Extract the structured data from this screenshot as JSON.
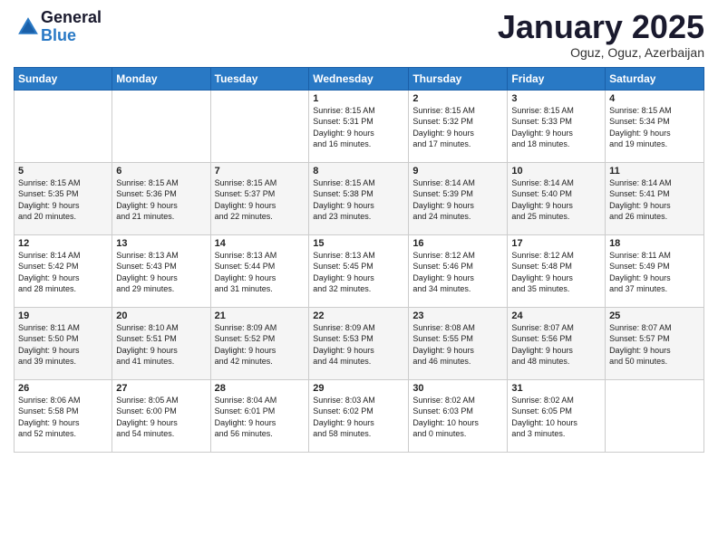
{
  "logo": {
    "general": "General",
    "blue": "Blue"
  },
  "title": "January 2025",
  "location": "Oguz, Oguz, Azerbaijan",
  "headers": [
    "Sunday",
    "Monday",
    "Tuesday",
    "Wednesday",
    "Thursday",
    "Friday",
    "Saturday"
  ],
  "weeks": [
    [
      {
        "day": "",
        "info": ""
      },
      {
        "day": "",
        "info": ""
      },
      {
        "day": "",
        "info": ""
      },
      {
        "day": "1",
        "info": "Sunrise: 8:15 AM\nSunset: 5:31 PM\nDaylight: 9 hours\nand 16 minutes."
      },
      {
        "day": "2",
        "info": "Sunrise: 8:15 AM\nSunset: 5:32 PM\nDaylight: 9 hours\nand 17 minutes."
      },
      {
        "day": "3",
        "info": "Sunrise: 8:15 AM\nSunset: 5:33 PM\nDaylight: 9 hours\nand 18 minutes."
      },
      {
        "day": "4",
        "info": "Sunrise: 8:15 AM\nSunset: 5:34 PM\nDaylight: 9 hours\nand 19 minutes."
      }
    ],
    [
      {
        "day": "5",
        "info": "Sunrise: 8:15 AM\nSunset: 5:35 PM\nDaylight: 9 hours\nand 20 minutes."
      },
      {
        "day": "6",
        "info": "Sunrise: 8:15 AM\nSunset: 5:36 PM\nDaylight: 9 hours\nand 21 minutes."
      },
      {
        "day": "7",
        "info": "Sunrise: 8:15 AM\nSunset: 5:37 PM\nDaylight: 9 hours\nand 22 minutes."
      },
      {
        "day": "8",
        "info": "Sunrise: 8:15 AM\nSunset: 5:38 PM\nDaylight: 9 hours\nand 23 minutes."
      },
      {
        "day": "9",
        "info": "Sunrise: 8:14 AM\nSunset: 5:39 PM\nDaylight: 9 hours\nand 24 minutes."
      },
      {
        "day": "10",
        "info": "Sunrise: 8:14 AM\nSunset: 5:40 PM\nDaylight: 9 hours\nand 25 minutes."
      },
      {
        "day": "11",
        "info": "Sunrise: 8:14 AM\nSunset: 5:41 PM\nDaylight: 9 hours\nand 26 minutes."
      }
    ],
    [
      {
        "day": "12",
        "info": "Sunrise: 8:14 AM\nSunset: 5:42 PM\nDaylight: 9 hours\nand 28 minutes."
      },
      {
        "day": "13",
        "info": "Sunrise: 8:13 AM\nSunset: 5:43 PM\nDaylight: 9 hours\nand 29 minutes."
      },
      {
        "day": "14",
        "info": "Sunrise: 8:13 AM\nSunset: 5:44 PM\nDaylight: 9 hours\nand 31 minutes."
      },
      {
        "day": "15",
        "info": "Sunrise: 8:13 AM\nSunset: 5:45 PM\nDaylight: 9 hours\nand 32 minutes."
      },
      {
        "day": "16",
        "info": "Sunrise: 8:12 AM\nSunset: 5:46 PM\nDaylight: 9 hours\nand 34 minutes."
      },
      {
        "day": "17",
        "info": "Sunrise: 8:12 AM\nSunset: 5:48 PM\nDaylight: 9 hours\nand 35 minutes."
      },
      {
        "day": "18",
        "info": "Sunrise: 8:11 AM\nSunset: 5:49 PM\nDaylight: 9 hours\nand 37 minutes."
      }
    ],
    [
      {
        "day": "19",
        "info": "Sunrise: 8:11 AM\nSunset: 5:50 PM\nDaylight: 9 hours\nand 39 minutes."
      },
      {
        "day": "20",
        "info": "Sunrise: 8:10 AM\nSunset: 5:51 PM\nDaylight: 9 hours\nand 41 minutes."
      },
      {
        "day": "21",
        "info": "Sunrise: 8:09 AM\nSunset: 5:52 PM\nDaylight: 9 hours\nand 42 minutes."
      },
      {
        "day": "22",
        "info": "Sunrise: 8:09 AM\nSunset: 5:53 PM\nDaylight: 9 hours\nand 44 minutes."
      },
      {
        "day": "23",
        "info": "Sunrise: 8:08 AM\nSunset: 5:55 PM\nDaylight: 9 hours\nand 46 minutes."
      },
      {
        "day": "24",
        "info": "Sunrise: 8:07 AM\nSunset: 5:56 PM\nDaylight: 9 hours\nand 48 minutes."
      },
      {
        "day": "25",
        "info": "Sunrise: 8:07 AM\nSunset: 5:57 PM\nDaylight: 9 hours\nand 50 minutes."
      }
    ],
    [
      {
        "day": "26",
        "info": "Sunrise: 8:06 AM\nSunset: 5:58 PM\nDaylight: 9 hours\nand 52 minutes."
      },
      {
        "day": "27",
        "info": "Sunrise: 8:05 AM\nSunset: 6:00 PM\nDaylight: 9 hours\nand 54 minutes."
      },
      {
        "day": "28",
        "info": "Sunrise: 8:04 AM\nSunset: 6:01 PM\nDaylight: 9 hours\nand 56 minutes."
      },
      {
        "day": "29",
        "info": "Sunrise: 8:03 AM\nSunset: 6:02 PM\nDaylight: 9 hours\nand 58 minutes."
      },
      {
        "day": "30",
        "info": "Sunrise: 8:02 AM\nSunset: 6:03 PM\nDaylight: 10 hours\nand 0 minutes."
      },
      {
        "day": "31",
        "info": "Sunrise: 8:02 AM\nSunset: 6:05 PM\nDaylight: 10 hours\nand 3 minutes."
      },
      {
        "day": "",
        "info": ""
      }
    ]
  ]
}
